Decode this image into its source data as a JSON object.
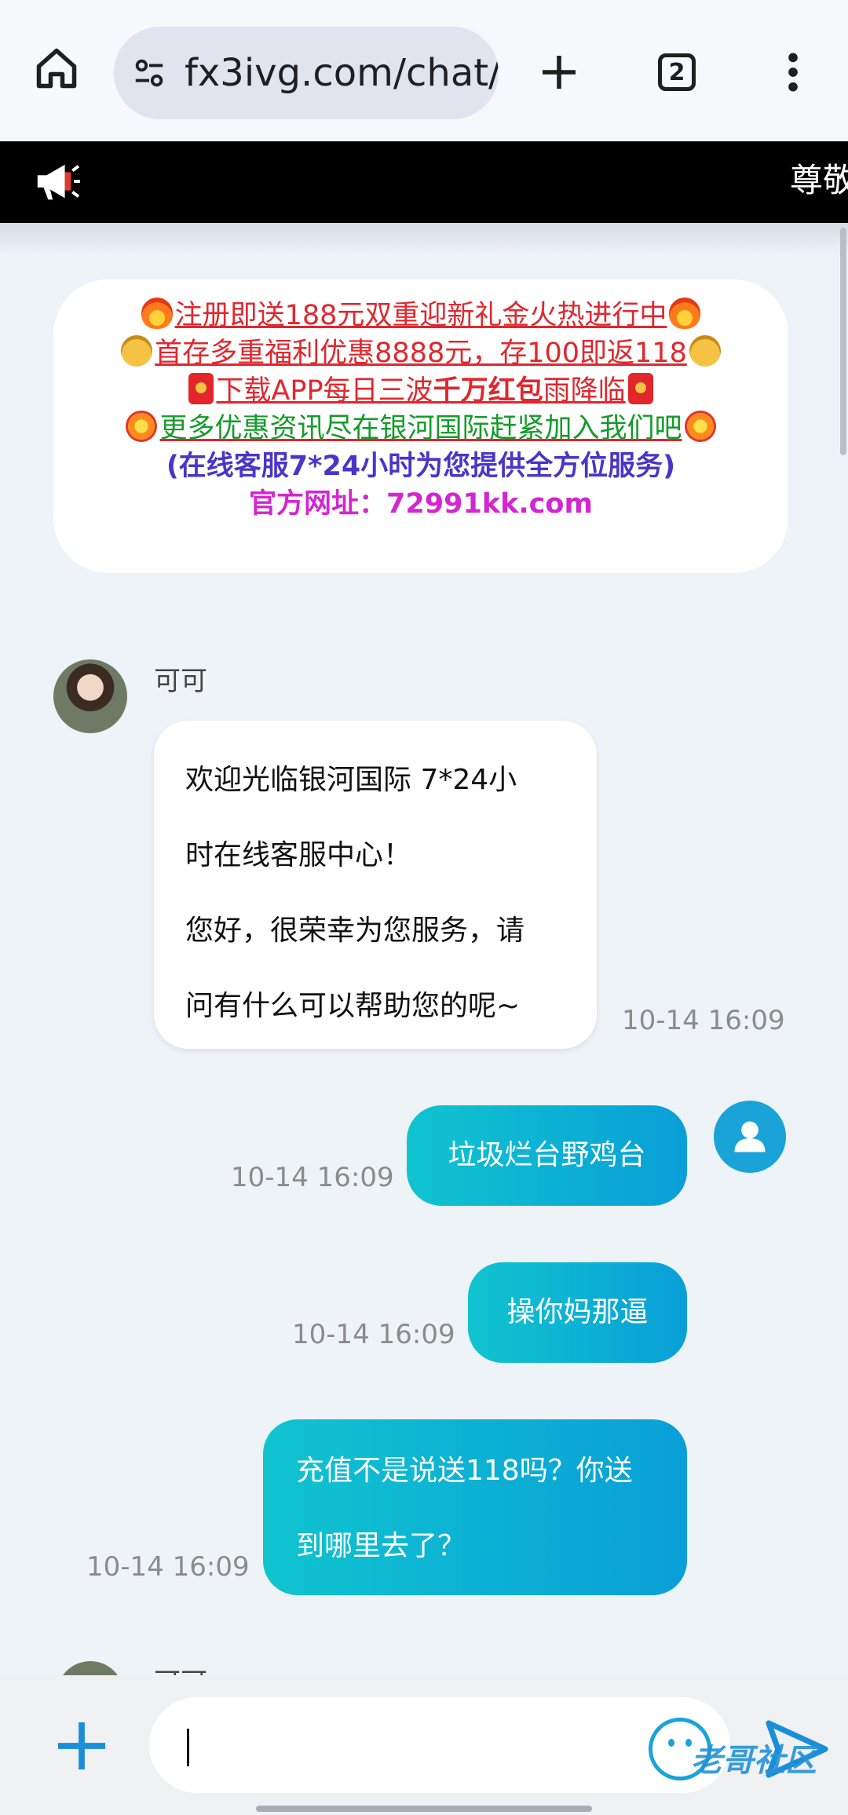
{
  "browser": {
    "url": "fx3ivg.com/chat/",
    "tab_count": "2"
  },
  "marquee": {
    "text": "尊敬"
  },
  "promo": {
    "line1": "注册即送188元双重迎新礼金火热进行中",
    "line2": "首存多重福利优惠8888元，存100即返118",
    "line3_a": "下载APP每日三波",
    "line3_b": "千万红包",
    "line3_c": "雨降临",
    "line4": "更多优惠资讯尽在银河国际赶紧加入我们吧",
    "line5": "(在线客服7*24小时为您提供全方位服务)",
    "line6": "官方网址：72991kk.com"
  },
  "chat": {
    "agent_name": "可可",
    "agent_message_lines": [
      "欢迎光临银河国际 7*24小",
      "时在线客服中心！",
      "您好，很荣幸为您服务，请",
      "问有什么可以帮助您的呢~"
    ],
    "agent_timestamp": "10-14 16:09",
    "user_messages": [
      {
        "text": "垃圾烂台野鸡台",
        "time": "10-14 16:09"
      },
      {
        "text": "操你妈那逼",
        "time": "10-14 16:09"
      },
      {
        "text_lines": [
          "充值不是说送118吗？你送",
          "到哪里去了？"
        ],
        "time": "10-14 16:09"
      }
    ],
    "next_sender_name": "可可"
  },
  "input": {
    "value": ""
  },
  "watermark": "老哥社区"
}
